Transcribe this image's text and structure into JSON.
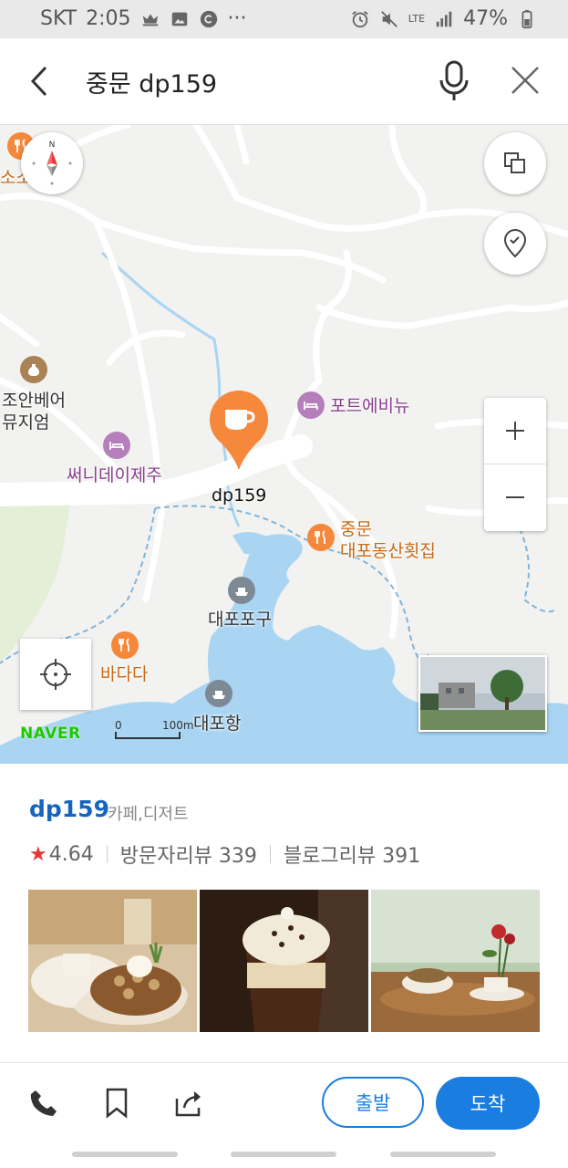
{
  "status_bar": {
    "carrier": "SKT",
    "time": "2:05",
    "dots": "···",
    "network": "LTE",
    "battery": "47%"
  },
  "search": {
    "query": "중문 dp159"
  },
  "map": {
    "pois": {
      "sosso": "소소",
      "museum": "조안베어\n뮤지엄",
      "fort_avenue": "포트에비뉴",
      "sunny_day": "써니데이제주",
      "target_cafe": "dp159",
      "restaurant": "중문\n대포동산횟집",
      "daepo_port_gu": "대포포구",
      "badada": "바다다",
      "daepo_port": "대포항"
    },
    "brand": "NAVER",
    "scale_zero": "0",
    "scale_label": "100m",
    "colors": {
      "water": "#a9d5f3",
      "green": "#e3efd6",
      "pin": "#f5883b",
      "purple": "#b57fbb"
    }
  },
  "place": {
    "name": "dp159",
    "category": "카페,디저트",
    "rating": "4.64",
    "visitor_reviews_label": "방문자리뷰 339",
    "blog_reviews_label": "블로그리뷰 391"
  },
  "actions": {
    "depart": "출발",
    "arrive": "도착",
    "accent": "#1a7de0"
  }
}
